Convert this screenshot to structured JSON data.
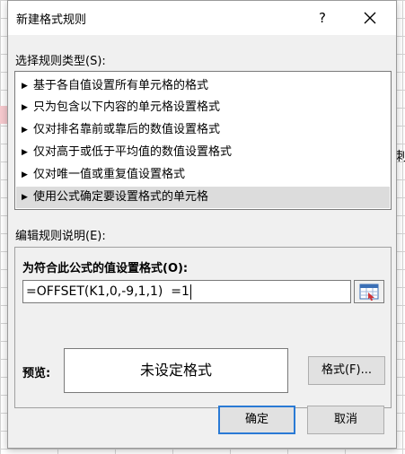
{
  "dialog": {
    "title": "新建格式规则",
    "help": "?",
    "rule_type_label": "选择规则类型(S):",
    "rule_types": [
      {
        "label": "基于各自值设置所有单元格的格式",
        "selected": false
      },
      {
        "label": "只为包含以下内容的单元格设置格式",
        "selected": false
      },
      {
        "label": "仅对排名靠前或靠后的数值设置格式",
        "selected": false
      },
      {
        "label": "仅对高于或低于平均值的数值设置格式",
        "selected": false
      },
      {
        "label": "仅对唯一值或重复值设置格式",
        "selected": false
      },
      {
        "label": "使用公式确定要设置格式的单元格",
        "selected": true
      }
    ],
    "edit_label": "编辑规则说明(E):",
    "formula_label": "为符合此公式的值设置格式(O):",
    "formula_value": "=OFFSET(K1,0,-9,1,1)  =1",
    "preview_label": "预览:",
    "preview_text": "未设定格式",
    "format_button": "格式(F)...",
    "ok_button": "确定",
    "cancel_button": "取消"
  },
  "background": {
    "edge_char": "刺"
  },
  "colors": {
    "selection": "#dcdcdc",
    "default_button_border": "#2a7ad5",
    "dialog_bg": "#f0f0f0"
  }
}
